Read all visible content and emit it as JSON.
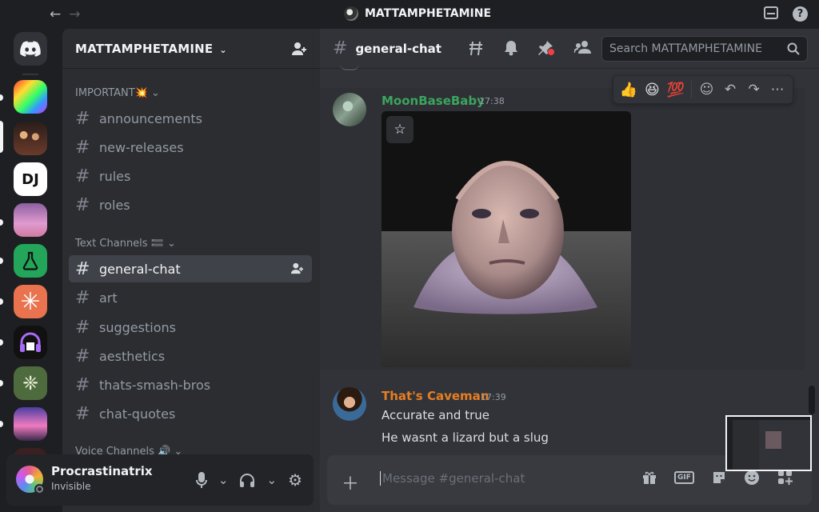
{
  "titlebar": {
    "back_icon": "arrow-left-icon",
    "forward_icon": "arrow-right-icon",
    "server_name": "MATTAMPHETAMINE"
  },
  "server_rail": {
    "home_icon": "discord-logo-icon",
    "servers": [
      {
        "name": "positive-ff-server",
        "color": "#e5489c"
      },
      {
        "name": "group-photo-server",
        "color": "#6b3b2b"
      },
      {
        "name": "dj-server",
        "text": "DJ",
        "color": "#ffffff"
      },
      {
        "name": "pink-photo-server",
        "color": "#c27bb0"
      },
      {
        "name": "flask-server",
        "color": "#23a55a"
      },
      {
        "name": "asterisk-server",
        "color": "#e8734e"
      },
      {
        "name": "headphones-server",
        "color": "#7a48d6"
      },
      {
        "name": "ascii-server",
        "color": "#4e6b3e"
      },
      {
        "name": "sunset-server",
        "color": "#c870b8"
      }
    ]
  },
  "sidebar": {
    "server_name": "MATTAMPHETAMINE",
    "categories": {
      "important": "IMPORTANT💥",
      "text": "Text Channels 🟰",
      "voice": "Voice Channels 🔊"
    },
    "channels_important": [
      "announcements",
      "new-releases",
      "rules",
      "roles"
    ],
    "channels_text": [
      "general-chat",
      "art",
      "suggestions",
      "aesthetics",
      "thats-smash-bros",
      "chat-quotes"
    ]
  },
  "user": {
    "name": "Procrastinatrix",
    "status": "Invisible"
  },
  "chat": {
    "channel": "general-chat",
    "search_placeholder": "Search MATTAMPHETAMINE",
    "messages": [
      {
        "author": "MoonBaseBaby",
        "time": "17:38",
        "author_color": "#3ba55d"
      },
      {
        "author": "That's Caveman",
        "time": "17:39",
        "author_color": "#e67e22",
        "lines": [
          "Accurate and true",
          "He wasnt a lizard but a slug"
        ]
      }
    ],
    "reactions": [
      "👍",
      "😆",
      "💯"
    ],
    "composer_placeholder": "Message #general-chat"
  }
}
